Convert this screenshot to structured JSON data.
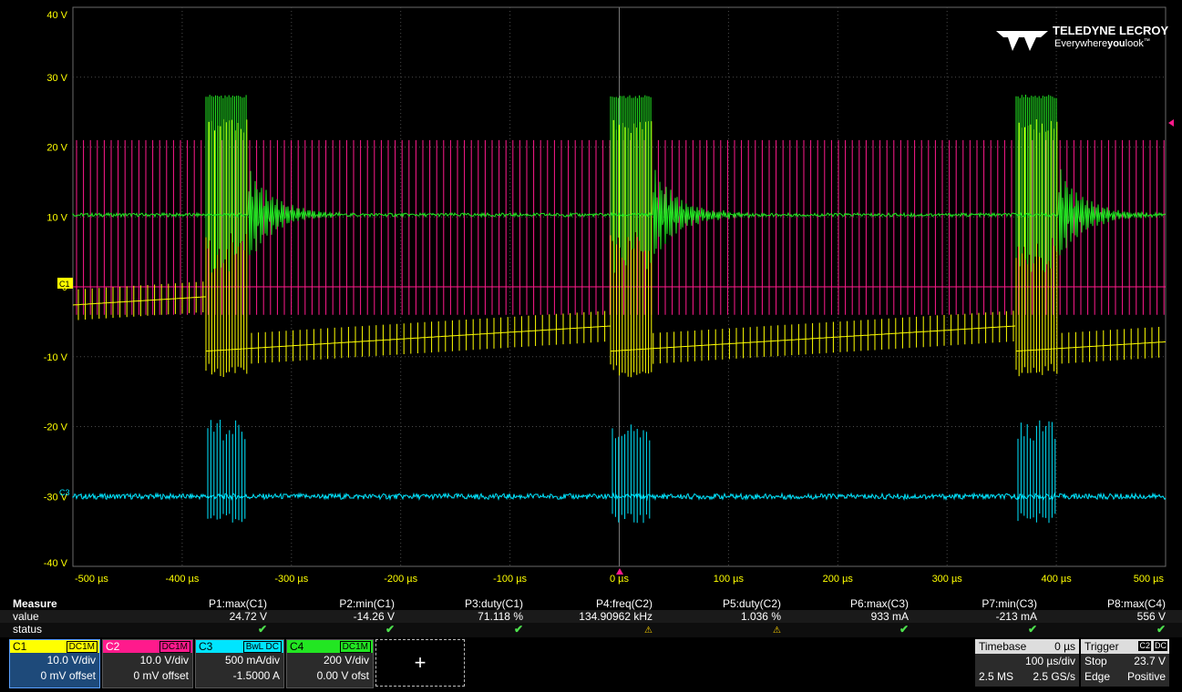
{
  "brand": {
    "name": "TELEDYNE LECROY",
    "tagline_a": "Everywhere",
    "tagline_b": "you",
    "tagline_c": "look",
    "tagline_tm": "™"
  },
  "y_axis_labels": [
    "40 V",
    "30 V",
    "20 V",
    "10 V",
    "0",
    "-10 V",
    "-20 V",
    "-30 V",
    "-40 V"
  ],
  "x_axis_labels": [
    "-500 µs",
    "-400 µs",
    "-300 µs",
    "-200 µs",
    "-100 µs",
    "0 µs",
    "100 µs",
    "200 µs",
    "300 µs",
    "400 µs",
    "500 µs"
  ],
  "markers": {
    "c1": "C1",
    "c3": "C3"
  },
  "measure": {
    "title": "Measure",
    "row_value": "value",
    "row_status": "status",
    "params": [
      {
        "name": "P1:max(C1)",
        "value": "24.72 V",
        "status": "ok"
      },
      {
        "name": "P2:min(C1)",
        "value": "-14.26 V",
        "status": "ok"
      },
      {
        "name": "P3:duty(C1)",
        "value": "71.118 %",
        "status": "ok"
      },
      {
        "name": "P4:freq(C2)",
        "value": "134.90962 kHz",
        "status": "warn"
      },
      {
        "name": "P5:duty(C2)",
        "value": "1.036 %",
        "status": "warn"
      },
      {
        "name": "P6:max(C3)",
        "value": "933 mA",
        "status": "ok"
      },
      {
        "name": "P7:min(C3)",
        "value": "-213 mA",
        "status": "ok"
      },
      {
        "name": "P8:max(C4)",
        "value": "556 V",
        "status": "ok"
      }
    ]
  },
  "channels": [
    {
      "name": "C1",
      "tag": "DC1M",
      "scale": "10.0 V/div",
      "offset": "0 mV offset",
      "color": "#ffff00"
    },
    {
      "name": "C2",
      "tag": "DC1M",
      "scale": "10.0 V/div",
      "offset": "0 mV offset",
      "color": "#ff1a8c"
    },
    {
      "name": "C3",
      "tag": "BwL DC",
      "scale": "500 mA/div",
      "offset": "-1.5000 A",
      "color": "#00e5ff"
    },
    {
      "name": "C4",
      "tag": "DC1M",
      "scale": "200 V/div",
      "offset": "0.00 V ofst",
      "color": "#22e622"
    }
  ],
  "add_symbol": "+",
  "timebase": {
    "label": "Timebase",
    "delay": "0 µs",
    "scale": "100 µs/div",
    "points": "2.5 MS",
    "rate": "2.5 GS/s"
  },
  "trigger": {
    "label": "Trigger",
    "source": "C2",
    "coupling": "DC",
    "mode": "Stop",
    "level": "23.7 V",
    "type": "Edge",
    "slope": "Positive"
  }
}
